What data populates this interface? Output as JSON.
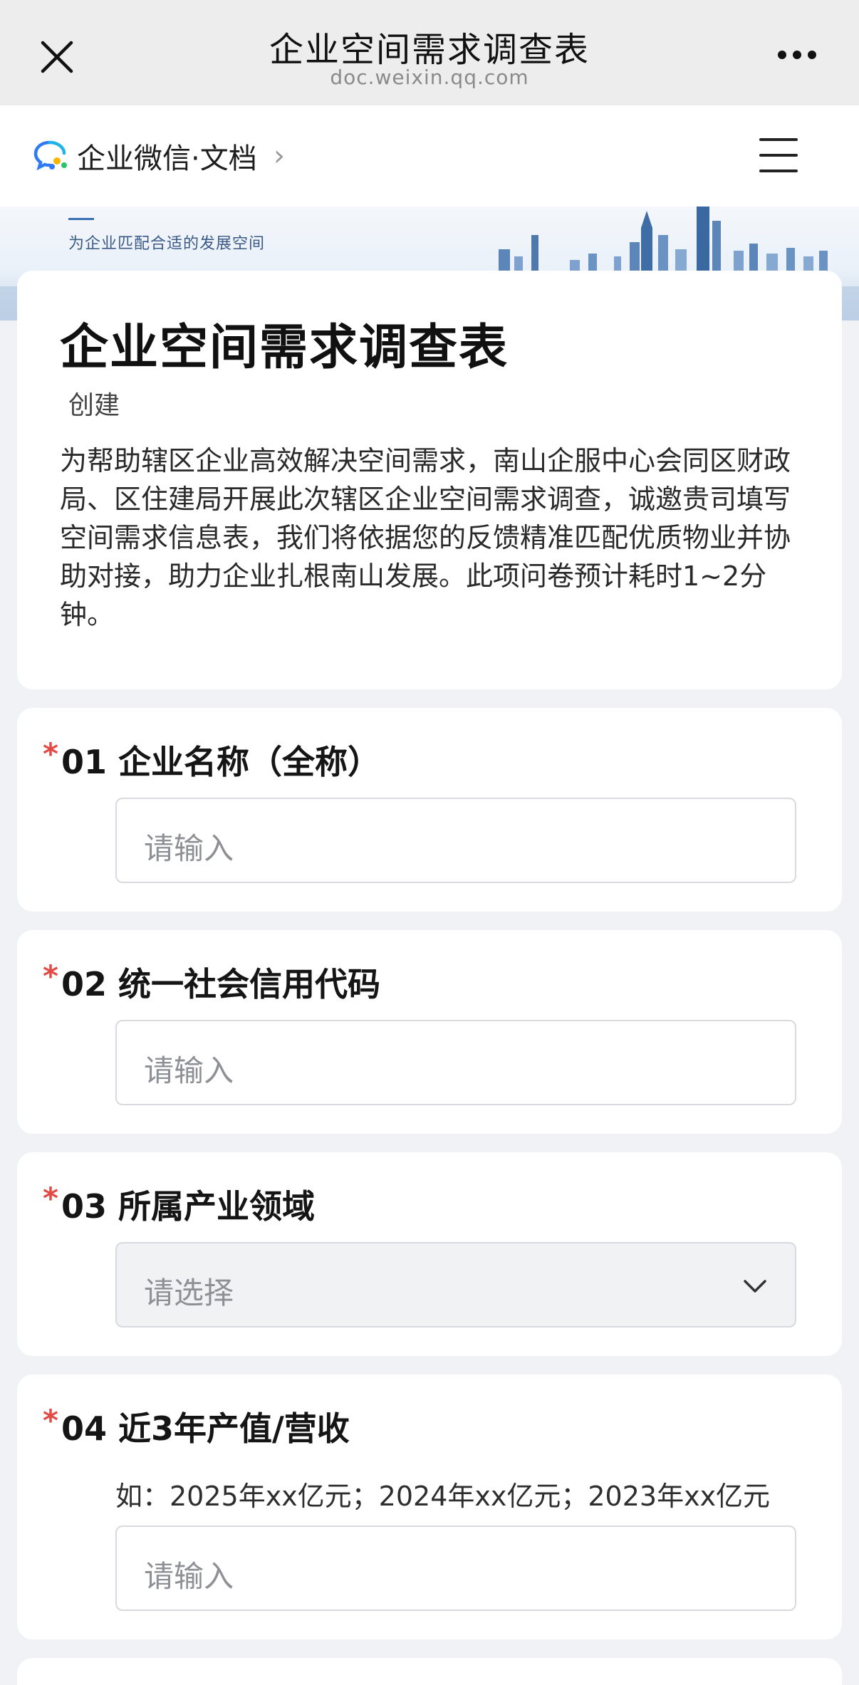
{
  "browser": {
    "title": "企业空间需求调查表",
    "url": "doc.weixin.qq.com"
  },
  "header": {
    "brand": "企业微信·文档"
  },
  "banner": {
    "slogan": "为企业匹配合适的发展空间"
  },
  "intro": {
    "title": "企业空间需求调查表",
    "creator": "创建",
    "description": "为帮助辖区企业高效解决空间需求，南山企服中心会同区财政局、区住建局开展此次辖区企业空间需求调查，诚邀贵司填写空间需求信息表，我们将依据您的反馈精准匹配优质物业并协助对接，助力企业扎根南山发展。此项问卷预计耗时1~2分钟。"
  },
  "questions": [
    {
      "required": "*",
      "label": "01 企业名称（全称）",
      "placeholder": "请输入"
    },
    {
      "required": "*",
      "label": "02 统一社会信用代码",
      "placeholder": "请输入"
    },
    {
      "required": "*",
      "label": "03 所属产业领域",
      "placeholder": "请选择"
    },
    {
      "required": "*",
      "label": "04 近3年产值/营收",
      "hint": "如：2025年xx亿元；2024年xx亿元；2023年xx亿元",
      "placeholder": "请输入"
    }
  ],
  "colors": {
    "required_star": "#e34a45",
    "page_bg": "#f1f2f5",
    "accent": "#2f7bf5"
  }
}
